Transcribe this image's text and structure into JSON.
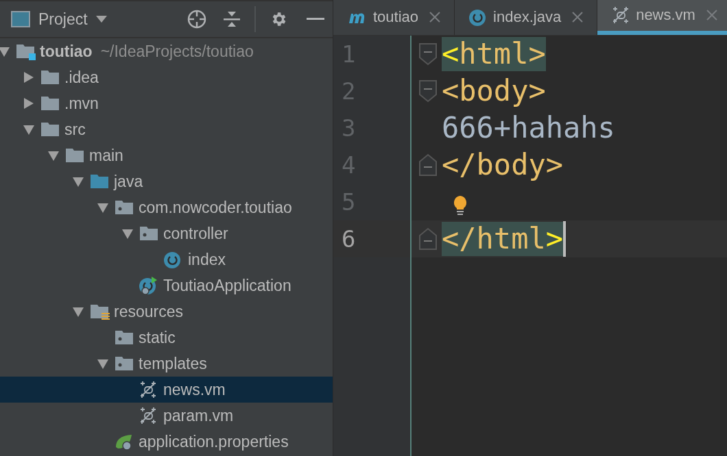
{
  "project_panel": {
    "title": "Project",
    "tree": [
      {
        "label": "toutiao",
        "path": "~/IdeaProjects/toutiao",
        "kind": "module",
        "expanded": true,
        "selected": false,
        "children": [
          {
            "label": ".idea",
            "kind": "folder",
            "expanded": false,
            "selected": false
          },
          {
            "label": ".mvn",
            "kind": "folder",
            "expanded": false,
            "selected": false
          },
          {
            "label": "src",
            "kind": "folder",
            "expanded": true,
            "selected": false,
            "children": [
              {
                "label": "main",
                "kind": "folder",
                "expanded": true,
                "selected": false,
                "children": [
                  {
                    "label": "java",
                    "kind": "source-folder",
                    "expanded": true,
                    "selected": false,
                    "children": [
                      {
                        "label": "com.nowcoder.toutiao",
                        "kind": "package",
                        "expanded": true,
                        "selected": false,
                        "children": [
                          {
                            "label": "controller",
                            "kind": "package",
                            "expanded": true,
                            "selected": false,
                            "children": [
                              {
                                "label": "index",
                                "kind": "class",
                                "selected": false
                              }
                            ]
                          },
                          {
                            "label": "ToutiaoApplication",
                            "kind": "app-class",
                            "selected": false
                          }
                        ]
                      }
                    ]
                  },
                  {
                    "label": "resources",
                    "kind": "resource-folder",
                    "expanded": true,
                    "selected": false,
                    "children": [
                      {
                        "label": "static",
                        "kind": "package",
                        "selected": false
                      },
                      {
                        "label": "templates",
                        "kind": "package",
                        "expanded": true,
                        "selected": false,
                        "children": [
                          {
                            "label": "news.vm",
                            "kind": "template",
                            "selected": true
                          },
                          {
                            "label": "param.vm",
                            "kind": "template",
                            "selected": false
                          }
                        ]
                      },
                      {
                        "label": "application.properties",
                        "kind": "properties",
                        "selected": false
                      }
                    ]
                  }
                ]
              }
            ]
          }
        ]
      }
    ]
  },
  "editor": {
    "tabs": [
      {
        "label": "toutiao",
        "kind": "maven",
        "selected": false
      },
      {
        "label": "index.java",
        "kind": "class",
        "selected": false
      },
      {
        "label": "news.vm",
        "kind": "template",
        "selected": true
      }
    ],
    "lines": [
      {
        "number": "1",
        "kind": "fold-start",
        "current": false,
        "tokens": [
          {
            "text": "<",
            "kind": "brace-match"
          },
          {
            "text": "html>",
            "kind": "tag"
          }
        ],
        "highlighted": true
      },
      {
        "number": "2",
        "kind": "fold-start",
        "current": false,
        "tokens": [
          {
            "text": "<body>",
            "kind": "tag"
          }
        ],
        "highlighted": false
      },
      {
        "number": "3",
        "kind": "plain",
        "current": false,
        "tokens": [
          {
            "text": "666+hahahs",
            "kind": "text"
          }
        ],
        "highlighted": false
      },
      {
        "number": "4",
        "kind": "fold-end",
        "current": false,
        "tokens": [
          {
            "text": "</body>",
            "kind": "tag"
          }
        ],
        "highlighted": false
      },
      {
        "number": "5",
        "kind": "plain",
        "current": false,
        "bulb": true
      },
      {
        "number": "6",
        "kind": "fold-end",
        "current": true,
        "tokens": [
          {
            "text": "</html",
            "kind": "tag"
          },
          {
            "text": ">",
            "kind": "brace-match"
          }
        ],
        "highlighted": true
      }
    ]
  }
}
